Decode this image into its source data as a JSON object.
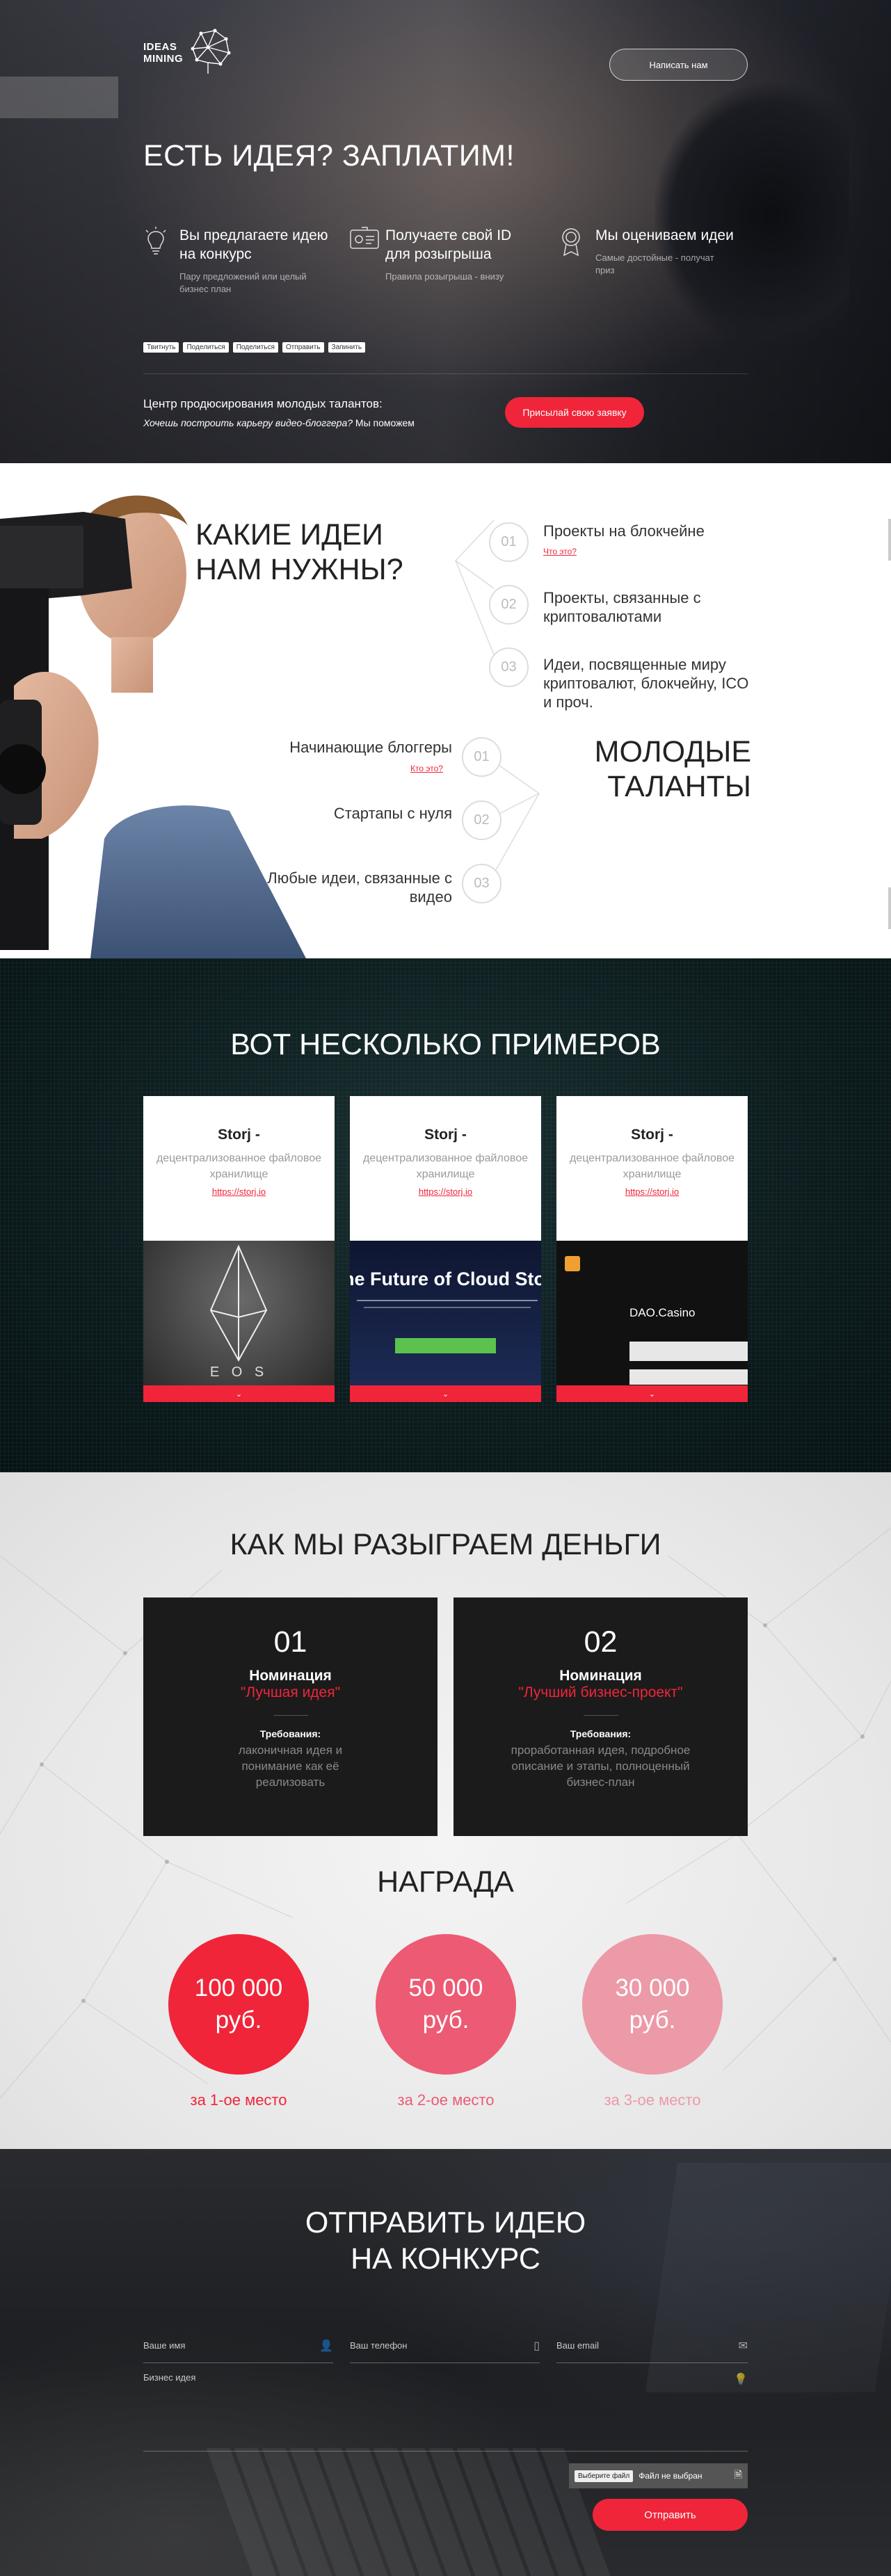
{
  "hero": {
    "logo_line1": "IDEAS",
    "logo_line2": "MINING",
    "contact_button": "Написать нам",
    "title": "ЕСТЬ ИДЕЯ? ЗАПЛАТИМ!",
    "features": [
      {
        "title": "Вы предлагаете идею на конкурс",
        "subtitle": "Пару предложений или целый бизнес план",
        "icon": "lightbulb-icon"
      },
      {
        "title": "Получаете свой ID для розыгрыша",
        "subtitle": "Правила розыгрыша - внизу",
        "icon": "id-card-icon"
      },
      {
        "title": "Мы оцениваем идеи",
        "subtitle": "Самые достойные - получат приз",
        "icon": "medal-icon"
      }
    ],
    "shares": [
      "Твитнуть",
      "Поделиться",
      "Поделиться",
      "Отправить",
      "Запинить"
    ],
    "center_label": "Центр продюсирования молодых талантов:",
    "center_question": "Хочешь построить карьеру видео-блоггера?",
    "center_answer": " Мы поможем",
    "apply_button": "Присылай свою заявку"
  },
  "ideas": {
    "title_line1": "КАКИЕ ИДЕИ",
    "title_line2": "НАМ НУЖНЫ?",
    "items": [
      {
        "num": "01",
        "text": "Проекты на блокчейне",
        "link": "Что это?"
      },
      {
        "num": "02",
        "text": "Проекты, связанные с криптовалютами"
      },
      {
        "num": "03",
        "text": "Идеи, посвященные миру криптовалют, блокчейну, ICO и проч."
      }
    ],
    "talents_title_line1": "МОЛОДЫЕ",
    "talents_title_line2": "ТАЛАНТЫ",
    "talents": [
      {
        "num": "01",
        "text": "Начинающие блоггеры",
        "link": "Кто это?"
      },
      {
        "num": "02",
        "text": "Стартапы с нуля"
      },
      {
        "num": "03",
        "text": "Любые идеи, связанные с видео"
      }
    ]
  },
  "examples": {
    "title": "ВОТ НЕСКОЛЬКО ПРИМЕРОВ",
    "cards": [
      {
        "name": "Storj -",
        "desc": "децентрализованное файловое хранилище",
        "link": "https://storj.io",
        "image_text": "E O S"
      },
      {
        "name": "Storj -",
        "desc": "децентрализованное файловое хранилище",
        "link": "https://storj.io",
        "image_text": "he Future of Cloud Stor"
      },
      {
        "name": "Storj -",
        "desc": "децентрализованное файловое хранилище",
        "link": "https://storj.io",
        "image_text": "DAO.Casino"
      }
    ]
  },
  "how": {
    "title": "КАК МЫ РАЗЫГРАЕМ ДЕНЬГИ",
    "nominations": [
      {
        "num": "01",
        "label": "Номинация",
        "value": "\"Лучшая идея\"",
        "req_label": "Требования:",
        "req": "лаконичная идея и понимание как её реализовать"
      },
      {
        "num": "02",
        "label": "Номинация",
        "value": "\"Лучший бизнес-проект\"",
        "req_label": "Требования:",
        "req": "проработанная идея, подробное описание и этапы, полноценный бизнес-план"
      }
    ],
    "reward_title": "НАГРАДА",
    "prizes": [
      {
        "amount": "100 000",
        "currency": "руб.",
        "label": "за 1-ое место",
        "color": "#f0253a"
      },
      {
        "amount": "50 000",
        "currency": "руб.",
        "label": "за 2-ое место",
        "color": "#ec5b73"
      },
      {
        "amount": "30 000",
        "currency": "руб.",
        "label": "за 3-ое место",
        "color": "#ec9aa8"
      }
    ]
  },
  "form": {
    "title_line1": "ОТПРАВИТЬ ИДЕЮ",
    "title_line2": "НА КОНКУРС",
    "name_placeholder": "Ваше имя",
    "phone_placeholder": "Ваш телефон",
    "email_placeholder": "Ваш email",
    "idea_placeholder": "Бизнес идея",
    "file_button": "Выберите файл",
    "file_status": "Файл не выбран",
    "submit": "Отправить"
  },
  "colors": {
    "accent": "#f0253a",
    "dark": "#1b1b1b"
  }
}
